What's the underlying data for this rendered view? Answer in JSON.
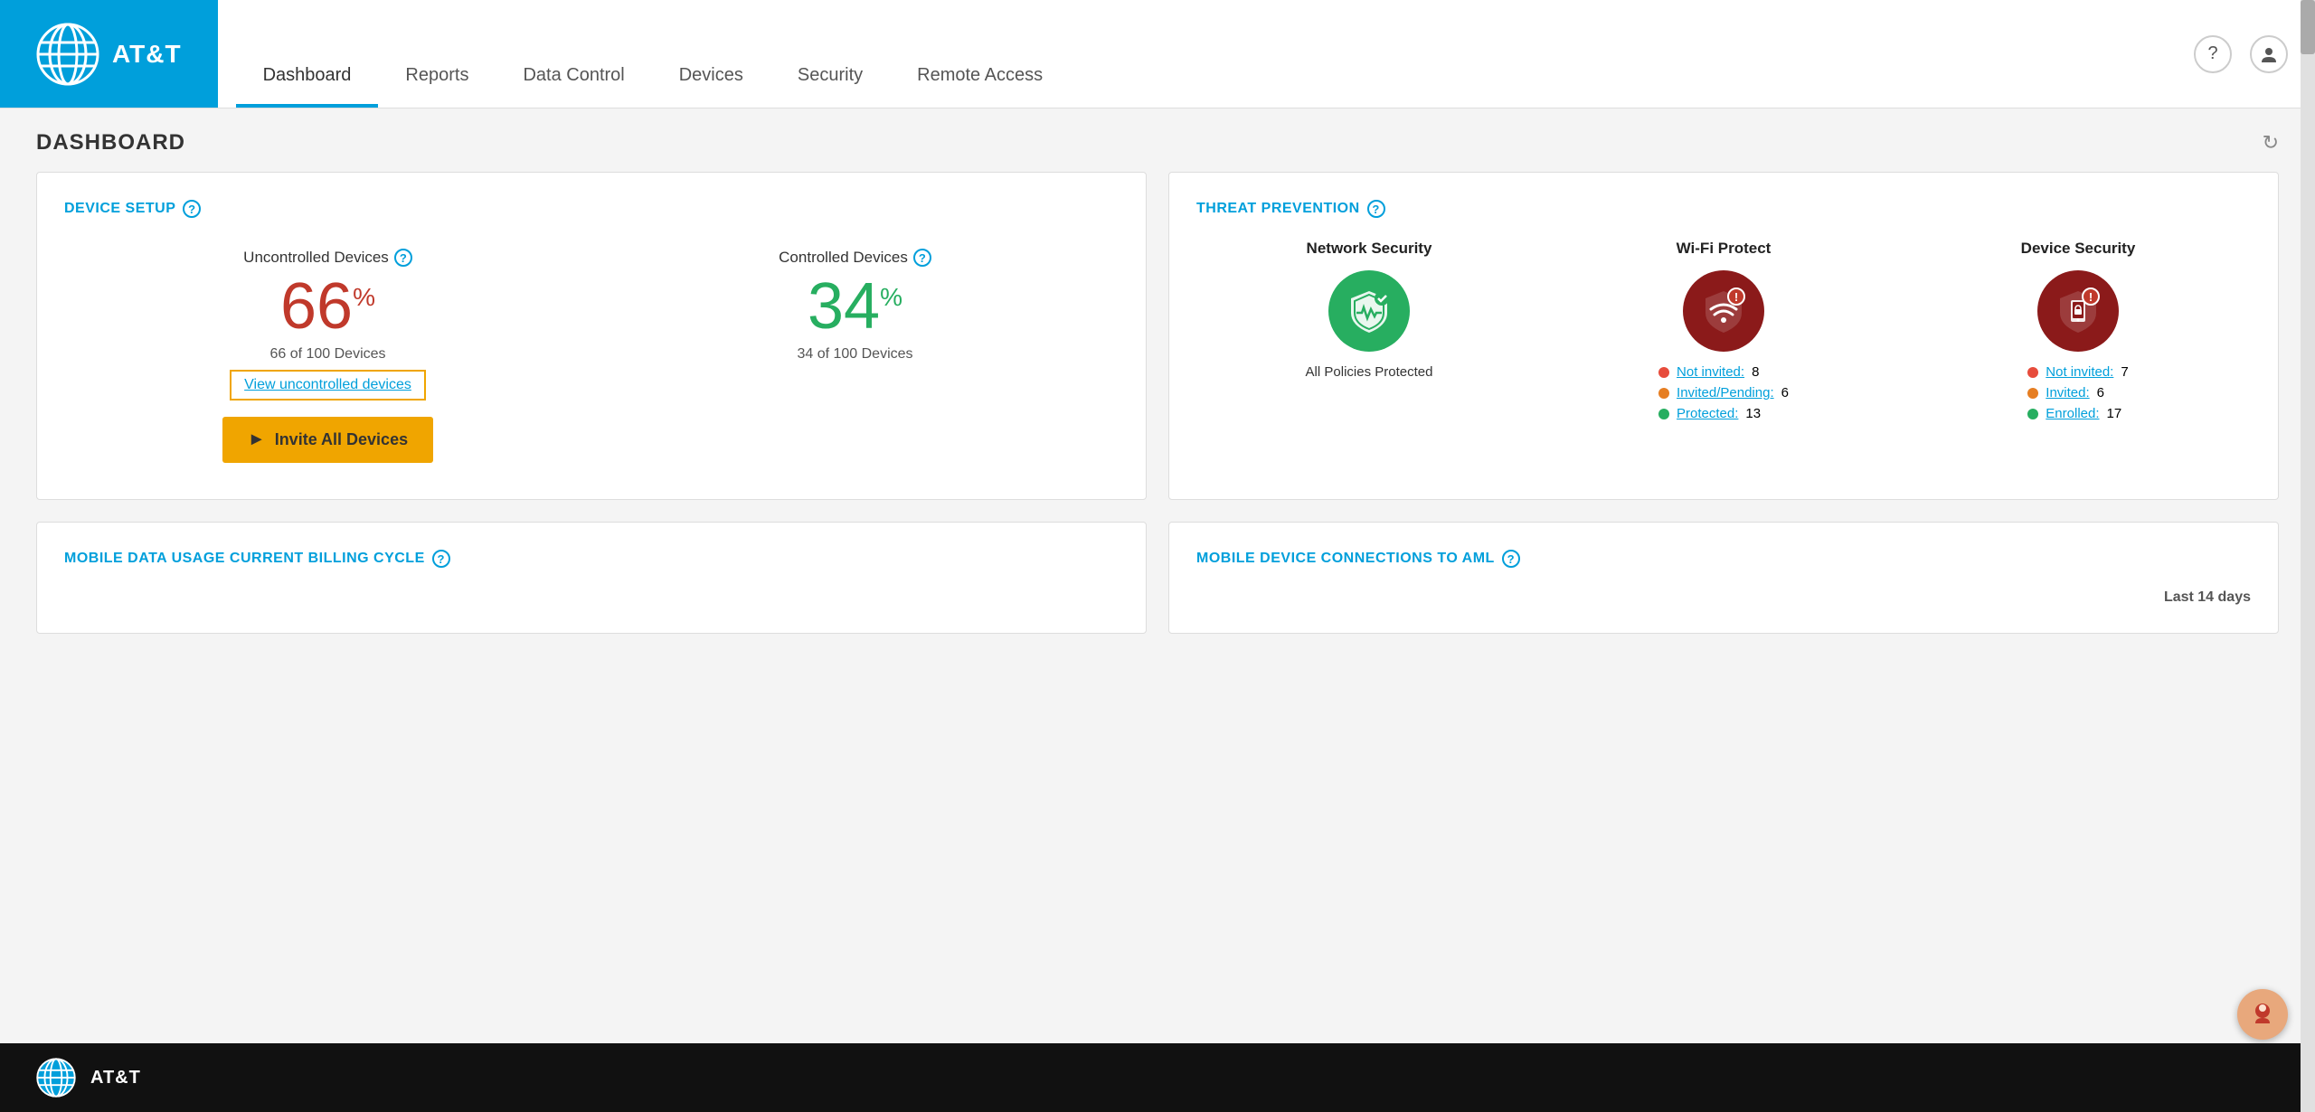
{
  "header": {
    "brand": "AT&T",
    "nav": {
      "tabs": [
        {
          "label": "Dashboard",
          "active": true
        },
        {
          "label": "Reports",
          "active": false
        },
        {
          "label": "Data Control",
          "active": false
        },
        {
          "label": "Devices",
          "active": false
        },
        {
          "label": "Security",
          "active": false
        },
        {
          "label": "Remote Access",
          "active": false
        }
      ]
    },
    "help_icon": "?",
    "user_icon": "person"
  },
  "page": {
    "title": "DASHBOARD",
    "refresh_icon": "↻"
  },
  "device_setup": {
    "section_title": "DEVICE SETUP",
    "help": "?",
    "uncontrolled": {
      "label": "Uncontrolled Devices",
      "percent": "66",
      "suffix": "%",
      "count": "66 of 100 Devices",
      "view_link": "View uncontrolled devices"
    },
    "controlled": {
      "label": "Controlled Devices",
      "percent": "34",
      "suffix": "%",
      "count": "34 of 100 Devices"
    },
    "invite_btn": "Invite All Devices"
  },
  "threat_prevention": {
    "section_title": "THREAT PREVENTION",
    "help": "?",
    "columns": [
      {
        "title": "Network Security",
        "icon_type": "green",
        "status": "All Policies Protected",
        "stats": []
      },
      {
        "title": "Wi-Fi Protect",
        "icon_type": "red",
        "status": "",
        "stats": [
          {
            "dot": "red",
            "label": "Not invited:",
            "value": "8"
          },
          {
            "dot": "orange",
            "label": "Invited/Pending:",
            "value": "6"
          },
          {
            "dot": "green",
            "label": "Protected:",
            "value": "13"
          }
        ]
      },
      {
        "title": "Device Security",
        "icon_type": "red",
        "status": "",
        "stats": [
          {
            "dot": "red",
            "label": "Not invited:",
            "value": "7"
          },
          {
            "dot": "orange",
            "label": "Invited:",
            "value": "6"
          },
          {
            "dot": "green",
            "label": "Enrolled:",
            "value": "17"
          }
        ]
      }
    ]
  },
  "bottom_cards": [
    {
      "title": "MOBILE DATA USAGE CURRENT BILLING CYCLE",
      "help": "?"
    },
    {
      "title": "MOBILE DEVICE CONNECTIONS TO AML",
      "help": "?",
      "subtitle": "Last 14 days"
    }
  ],
  "footer": {
    "brand": "AT&T"
  }
}
